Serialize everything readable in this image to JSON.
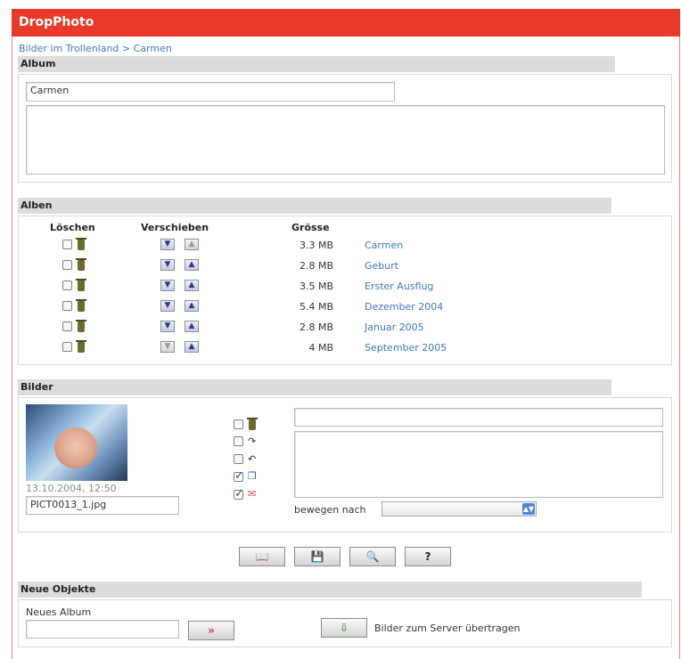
{
  "app": {
    "title": "DropPhoto"
  },
  "breadcrumb": {
    "parent": "Bilder im Trollenland",
    "separator": ">",
    "current": "Carmen"
  },
  "album_section": {
    "heading": "Album",
    "name_value": "Carmen",
    "description_value": ""
  },
  "albums_section": {
    "heading": "Alben",
    "col_delete": "Löschen",
    "col_move": "Verschieben",
    "col_size": "Grösse",
    "rows": [
      {
        "size": "3.3 MB",
        "name": "Carmen"
      },
      {
        "size": "2.8 MB",
        "name": "Geburt"
      },
      {
        "size": "3.5 MB",
        "name": "Erster Ausflug"
      },
      {
        "size": "5.4 MB",
        "name": "Dezember 2004"
      },
      {
        "size": "2.8 MB",
        "name": "Januar 2005"
      },
      {
        "size": "4 MB",
        "name": "September 2005"
      }
    ]
  },
  "pictures_section": {
    "heading": "Bilder",
    "timestamp": "13.10.2004, 12:50",
    "filename": "PICT0013_1.jpg",
    "title_value": "",
    "description_value": "",
    "move_label": "bewegen nach",
    "move_selected": "",
    "options": {
      "delete": false,
      "rotate_right": false,
      "rotate_left": false,
      "copy": true,
      "mail": true
    }
  },
  "toolbar": {
    "btn1": "📖",
    "btn2": "💾",
    "btn3": "🔍",
    "btn4": "?"
  },
  "new_objects": {
    "heading": "Neue Objekte",
    "new_album_label": "Neues Album",
    "new_album_value": "",
    "go_label": "»",
    "upload_label": "Bilder zum Server übertragen"
  },
  "icons": {
    "delete": "trash-icon",
    "move_down": "arrow-down-icon",
    "move_up": "arrow-up-icon",
    "rotate_right": "rotate-right-icon",
    "rotate_left": "rotate-left-icon",
    "copy": "copy-icon",
    "mail": "mail-icon",
    "upload": "upload-icon"
  },
  "colors": {
    "title_bar": "#e8392a",
    "link": "#3f78c0",
    "section_header": "#dcdcdc"
  }
}
